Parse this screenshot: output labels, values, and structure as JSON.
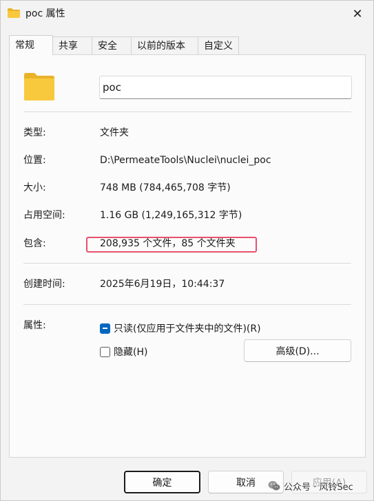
{
  "window": {
    "title": "poc 属性",
    "close_glyph": "✕"
  },
  "tabs": [
    {
      "label": "常规",
      "active": true
    },
    {
      "label": "共享",
      "active": false
    },
    {
      "label": "安全",
      "active": false
    },
    {
      "label": "以前的版本",
      "active": false
    },
    {
      "label": "自定义",
      "active": false
    }
  ],
  "general": {
    "folder_name": "poc",
    "rows": {
      "type": {
        "label": "类型:",
        "value": "文件夹"
      },
      "location": {
        "label": "位置:",
        "value": "D:\\PermeateTools\\Nuclei\\nuclei_poc"
      },
      "size": {
        "label": "大小:",
        "value": "748 MB (784,465,708 字节)"
      },
      "size_on_disk": {
        "label": "占用空间:",
        "value": "1.16 GB (1,249,165,312 字节)"
      },
      "contains": {
        "label": "包含:",
        "value": "208,935 个文件，85 个文件夹"
      },
      "created": {
        "label": "创建时间:",
        "value": "2025年6月19日，10:44:37"
      }
    },
    "attributes": {
      "label": "属性:",
      "readonly": {
        "label": "只读(仅应用于文件夹中的文件)(R)",
        "state": "indeterminate"
      },
      "hidden": {
        "label": "隐藏(H)",
        "state": "unchecked"
      },
      "advanced_label": "高级(D)..."
    }
  },
  "buttons": {
    "ok": "确定",
    "cancel": "取消",
    "apply": "应用(A)"
  },
  "watermark": {
    "text": "公众号 · 风铃Sec"
  },
  "colors": {
    "accent": "#0067c0",
    "highlight": "#e8506a",
    "folder": "#f8c93c"
  },
  "icons": {
    "title": "folder-icon",
    "large": "folder-icon",
    "close": "close-icon",
    "watermark": "wechat-icon"
  }
}
